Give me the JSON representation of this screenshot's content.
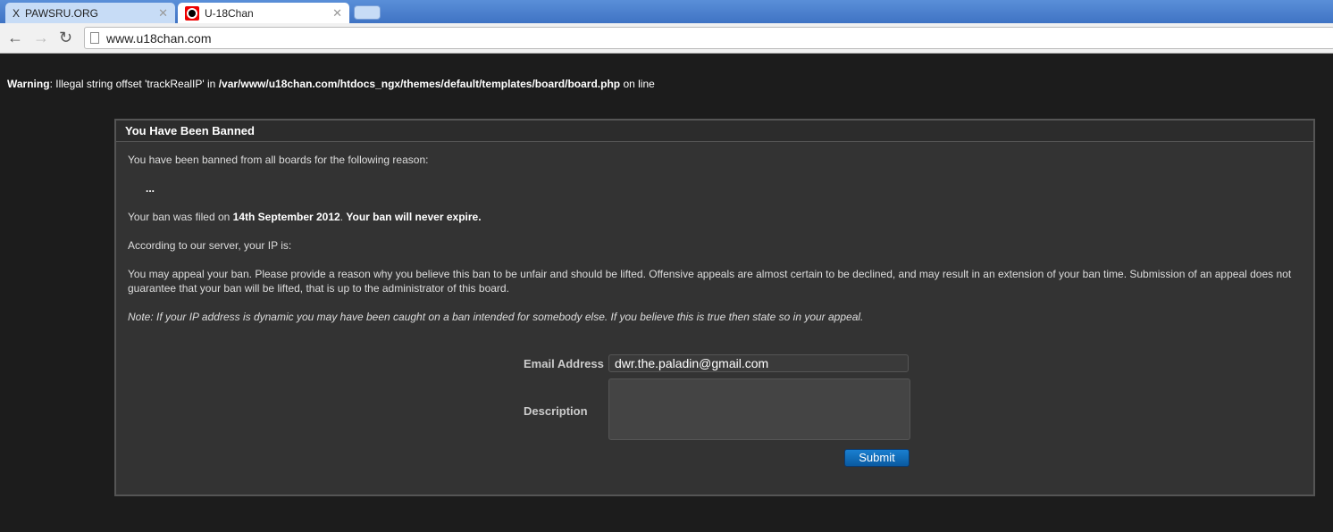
{
  "browser": {
    "tabs": [
      {
        "label": "PAWSRU.ORG",
        "icon": "X"
      },
      {
        "label": "U-18Chan"
      }
    ],
    "url": "www.u18chan.com"
  },
  "warning": {
    "label": "Warning",
    "text": ": Illegal string offset 'trackRealIP' in ",
    "path": "/var/www/u18chan.com/htdocs_ngx/themes/default/templates/board/board.php",
    "suffix": " on line"
  },
  "ban": {
    "title": "You Have Been Banned",
    "intro": "You have been banned from all boards for the following reason:",
    "reason": "...",
    "filed_prefix": "Your ban was filed on ",
    "filed_date": "14th September 2012",
    "filed_mid": ". ",
    "expiry": "Your ban will never expire.",
    "ip": "According to our server, your IP is:",
    "appeal": "You may appeal your ban. Please provide a reason why you believe this ban to be unfair and should be lifted. Offensive appeals are almost certain to be declined, and may result in an extension of your ban time. Submission of an appeal does not guarantee that your ban will be lifted, that is up to the administrator of this board.",
    "note": "Note: If your IP address is dynamic you may have been caught on a ban intended for somebody else. If you believe this is true then state so in your appeal."
  },
  "form": {
    "email_label": "Email Address",
    "email_value": "dwr.the.paladin@gmail.com",
    "description_label": "Description",
    "description_value": "",
    "submit_label": "Submit"
  }
}
